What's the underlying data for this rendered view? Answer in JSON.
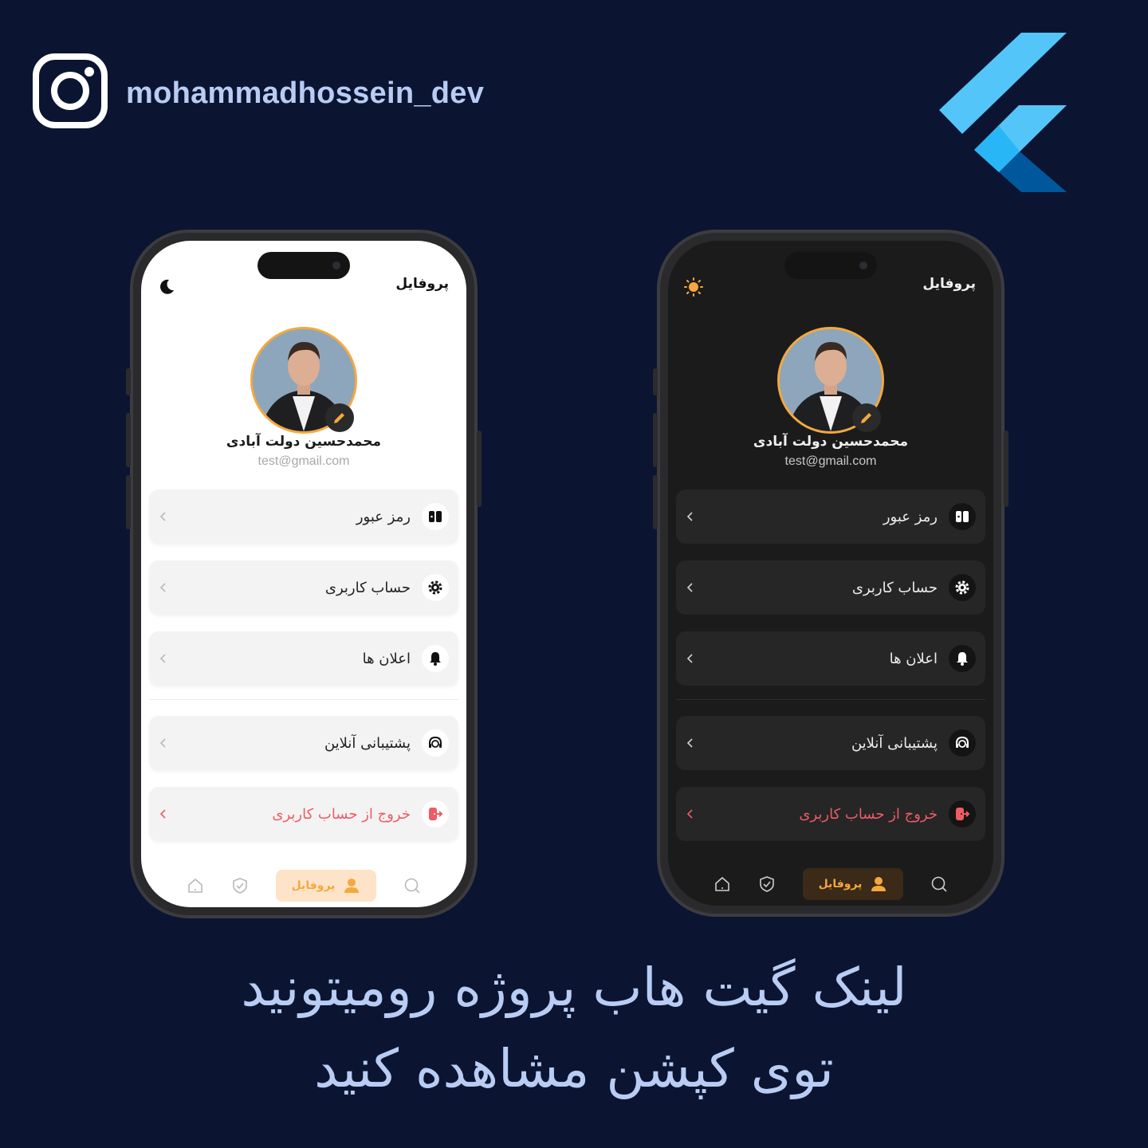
{
  "header": {
    "handle": "mohammadhossein_dev"
  },
  "icons": {
    "social": "instagram-icon",
    "framework": "flutter-logo"
  },
  "colors": {
    "background": "#0b1532",
    "accent": "#f5a83d",
    "danger": "#ef5b64",
    "text_highlight": "#b8ccf4"
  },
  "phones": {
    "light": {
      "title": "پروفایل",
      "theme_toggle_icon": "moon-icon",
      "name": "محمدحسین دولت آبادی",
      "email": "test@gmail.com",
      "menu": [
        {
          "label": "رمز عبور",
          "icon": "password-icon"
        },
        {
          "label": "حساب کاربری",
          "icon": "gear-icon"
        },
        {
          "label": "اعلان ها",
          "icon": "bell-icon"
        },
        {
          "label": "پشتیبانی آنلاین",
          "icon": "headset-icon"
        },
        {
          "label": "خروج از حساب کاربری",
          "icon": "logout-icon"
        }
      ],
      "nav": {
        "active_label": "پروفایل",
        "items": [
          "home-icon",
          "shield-icon",
          "user-icon",
          "search-icon"
        ]
      }
    },
    "dark": {
      "title": "پروفایل",
      "theme_toggle_icon": "sun-icon",
      "name": "محمدحسین دولت آبادی",
      "email": "test@gmail.com",
      "menu": [
        {
          "label": "رمز عبور",
          "icon": "password-icon"
        },
        {
          "label": "حساب کاربری",
          "icon": "gear-icon"
        },
        {
          "label": "اعلان ها",
          "icon": "bell-icon"
        },
        {
          "label": "پشتیبانی آنلاین",
          "icon": "headset-icon"
        },
        {
          "label": "خروج از حساب کاربری",
          "icon": "logout-icon"
        }
      ],
      "nav": {
        "active_label": "پروفایل",
        "items": [
          "home-icon",
          "shield-icon",
          "user-icon",
          "search-icon"
        ]
      }
    }
  },
  "caption": {
    "line1": "لینک گیت هاب پروژه رومیتونید",
    "line2": "توی کپشن مشاهده کنید"
  }
}
